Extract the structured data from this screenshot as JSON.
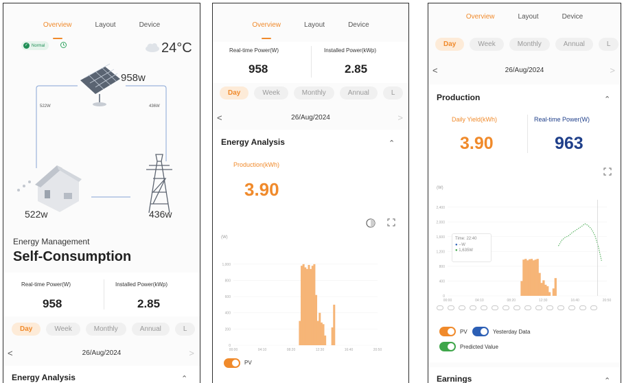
{
  "tabs": [
    "Overview",
    "Layout",
    "Device"
  ],
  "periods": [
    "Day",
    "Week",
    "Monthly",
    "Annual",
    "L"
  ],
  "date": "26/Aug/2024",
  "nav": {
    "prev": "<",
    "next": ">"
  },
  "colors": {
    "accent": "#f08a2b",
    "pv_bar": "#f6b577",
    "blue_value": "#1f3f8a",
    "predicted": "#3fa64a",
    "normal_badge": "#1f8f56"
  },
  "icons": [
    "refresh-icon",
    "cloud-icon",
    "solar-panel-icon",
    "house-icon",
    "power-tower-icon",
    "collapse-icon",
    "fullscreen-icon",
    "theme-icon"
  ],
  "screen1": {
    "status": "Normal",
    "temperature": "24°C",
    "flow": {
      "pv": "958w",
      "left_line": "522W",
      "right_line": "436W",
      "house": "522w",
      "grid": "436w"
    },
    "energy_management_label": "Energy Management",
    "mode": "Self-Consumption",
    "realtime_label": "Real-time Power(W)",
    "realtime_value": "958",
    "installed_label": "Installed Power(kWp)",
    "installed_value": "2.85",
    "section": "Energy Analysis"
  },
  "screen2": {
    "realtime_label": "Real-time Power(W)",
    "realtime_value": "958",
    "installed_label": "Installed Power(kWp)",
    "installed_value": "2.85",
    "section": "Energy Analysis",
    "production_label": "Production(kWh)",
    "production_value": "3.90",
    "unit": "(W)",
    "legend": "PV"
  },
  "screen3": {
    "section": "Production",
    "daily_yield_label": "Daily Yield(kWh)",
    "daily_yield_value": "3.90",
    "realtime_label": "Real-time Power(W)",
    "realtime_value": "963",
    "unit": "(W)",
    "tooltip": {
      "time": "Time: 22:40",
      "pv": "--W",
      "predicted": "1,635W"
    },
    "legend_pv": "PV",
    "legend_yesterday": "Yesterday Data",
    "legend_predicted": "Predicted Value",
    "earnings": "Earnings"
  },
  "chart_data": [
    {
      "type": "bar",
      "title": "",
      "ylabel": "(W)",
      "yticks": [
        "0",
        "200",
        "400",
        "600",
        "800",
        "1,000"
      ],
      "xticks": [
        "00:00",
        "04:10",
        "08:20",
        "12:30",
        "16:40",
        "20:50"
      ],
      "ylim": [
        0,
        1100
      ],
      "xlim_hours": [
        0,
        24
      ],
      "series": [
        {
          "name": "PV",
          "x": [
            10.9,
            11.2,
            11.5,
            11.8,
            12.1,
            12.4,
            12.7,
            13.0,
            13.3,
            13.6,
            13.9,
            14.2,
            14.5,
            14.8,
            15.1,
            15.4,
            15.7,
            16.0,
            16.3,
            16.6
          ],
          "values": [
            300,
            980,
            1000,
            960,
            940,
            990,
            940,
            980,
            1000,
            620,
            300,
            400,
            280,
            260,
            120,
            0,
            0,
            0,
            220,
            500
          ]
        }
      ]
    },
    {
      "type": "bar",
      "title": "",
      "ylabel": "(W)",
      "yticks": [
        "0",
        "400",
        "800",
        "1,200",
        "1,600",
        "2,000",
        "2,400"
      ],
      "xticks": [
        "00:00",
        "04:10",
        "08:20",
        "12:30",
        "16:40",
        "20:50"
      ],
      "ylim": [
        0,
        2600
      ],
      "xlim_hours": [
        0,
        24
      ],
      "series": [
        {
          "name": "PV",
          "x": [
            11.0,
            11.3,
            11.6,
            11.9,
            12.2,
            12.5,
            12.8,
            13.1,
            13.4,
            13.7,
            14.0,
            14.3,
            14.6,
            14.9,
            15.2,
            15.5,
            15.8,
            16.1
          ],
          "values": [
            400,
            980,
            1000,
            960,
            990,
            1000,
            960,
            980,
            1000,
            620,
            350,
            420,
            300,
            260,
            100,
            0,
            200,
            480
          ]
        },
        {
          "name": "Predicted Value",
          "x": [
            16.7,
            17.2,
            17.7,
            18.2,
            18.7,
            19.2,
            19.7,
            20.2,
            20.7,
            21.2,
            21.7,
            22.2,
            22.7,
            23.2
          ],
          "values": [
            1350,
            1500,
            1580,
            1620,
            1700,
            1760,
            1820,
            1880,
            1950,
            1900,
            1800,
            1635,
            1350,
            950
          ]
        }
      ]
    }
  ]
}
